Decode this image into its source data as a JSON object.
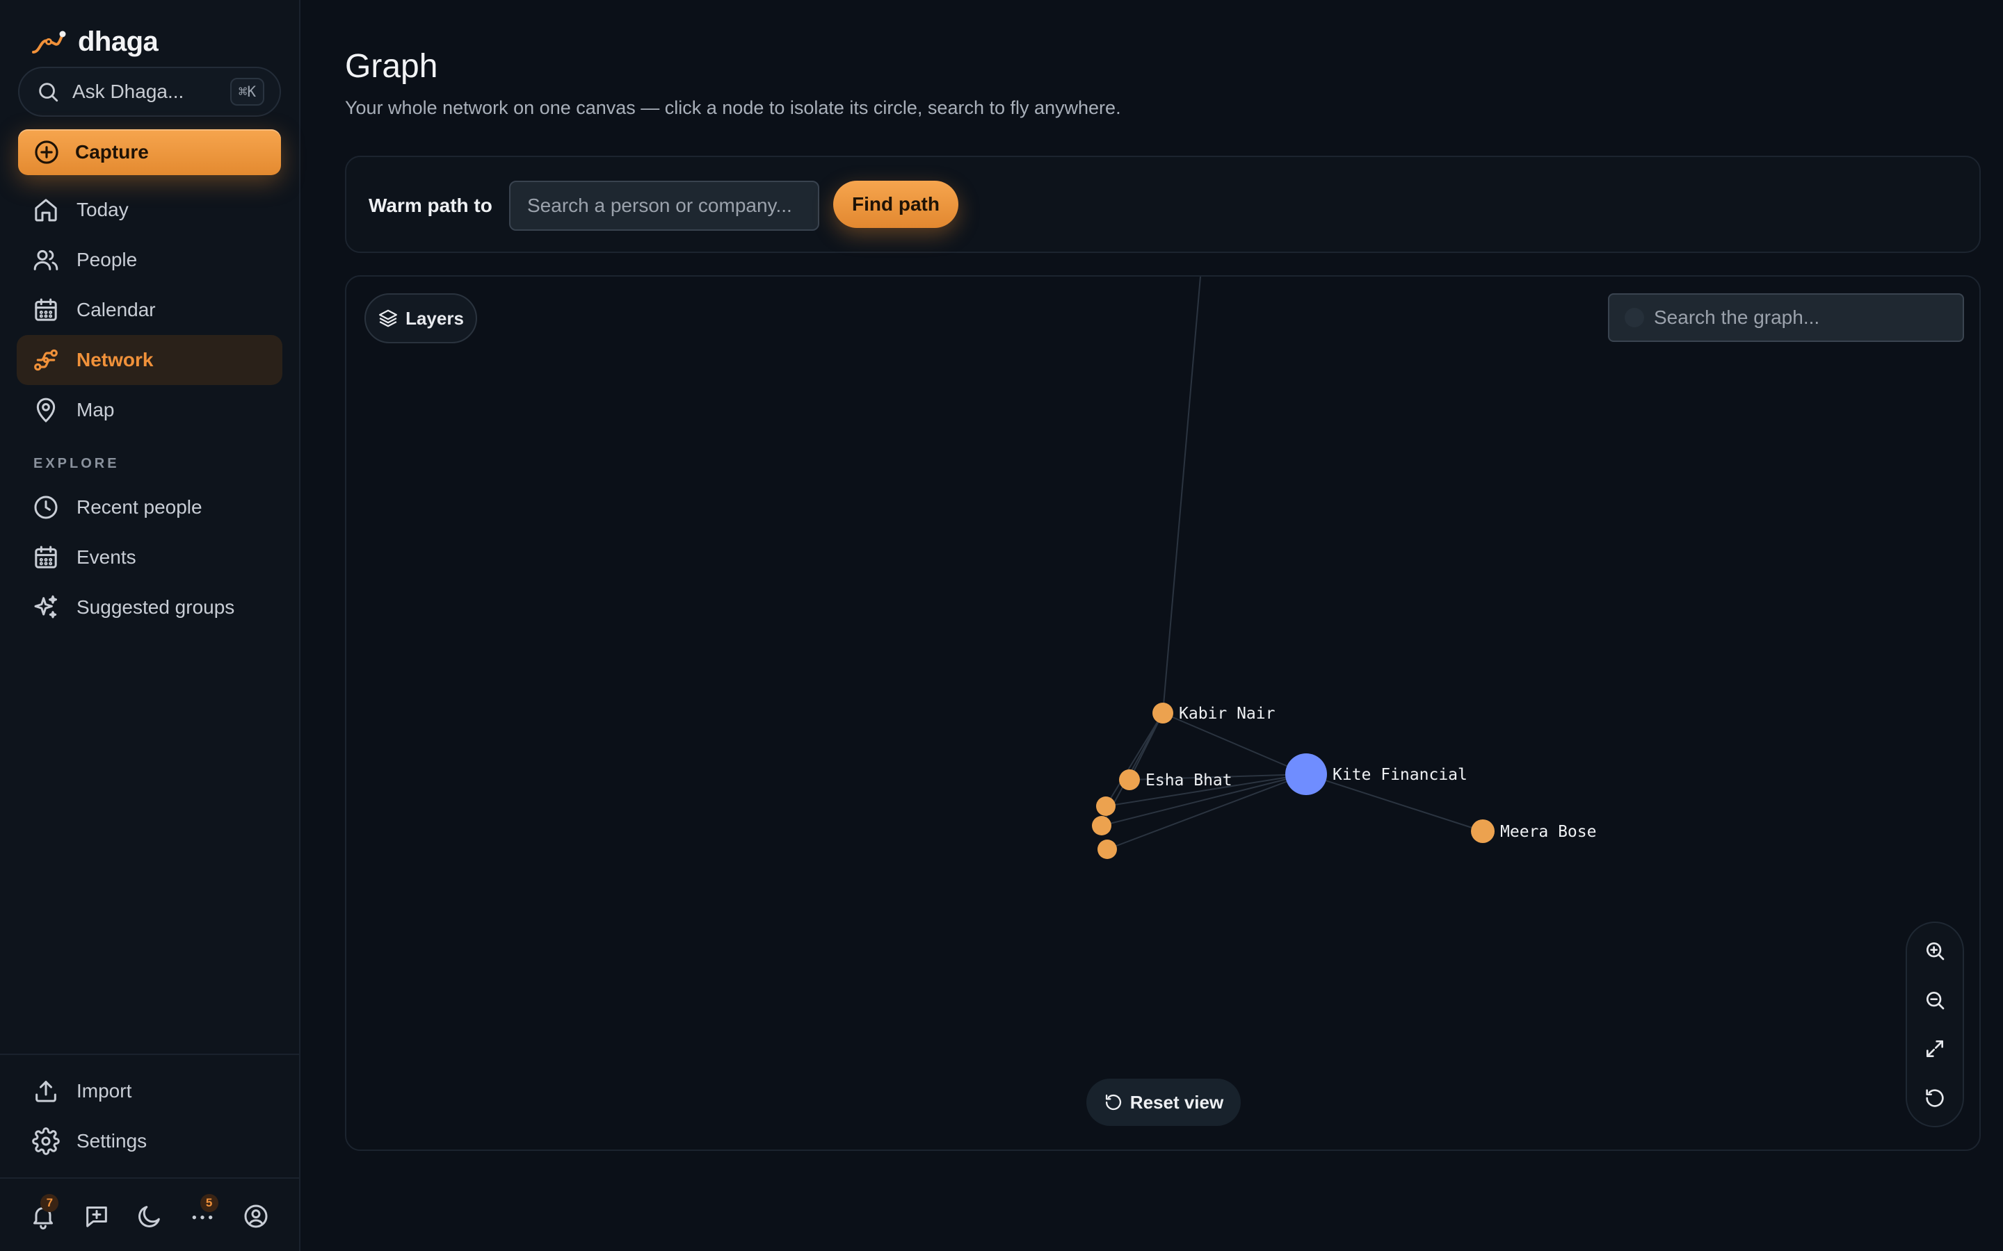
{
  "app": {
    "name": "dhaga"
  },
  "sidebar": {
    "ask_label": "Ask Dhaga...",
    "ask_shortcut": "⌘K",
    "capture_label": "Capture",
    "nav": [
      {
        "label": "Today",
        "icon": "home-icon"
      },
      {
        "label": "People",
        "icon": "people-icon"
      },
      {
        "label": "Calendar",
        "icon": "calendar-icon"
      },
      {
        "label": "Network",
        "icon": "network-icon",
        "active": true
      },
      {
        "label": "Map",
        "icon": "map-pin-icon"
      }
    ],
    "explore_label": "EXPLORE",
    "explore": [
      {
        "label": "Recent people",
        "icon": "clock-icon"
      },
      {
        "label": "Events",
        "icon": "calendar-icon"
      },
      {
        "label": "Suggested groups",
        "icon": "sparkles-icon"
      }
    ],
    "footer": [
      {
        "label": "Import",
        "icon": "upload-icon"
      },
      {
        "label": "Settings",
        "icon": "gear-icon"
      }
    ],
    "bottom_bar": {
      "notifications_count": "7",
      "more_count": "5"
    }
  },
  "main": {
    "title": "Graph",
    "subtitle": "Your whole network on one canvas — click a node to isolate its circle, search to fly anywhere.",
    "warm_path": {
      "label": "Warm path to",
      "placeholder": "Search a person or company...",
      "button": "Find path"
    },
    "graph": {
      "layers_label": "Layers",
      "search_placeholder": "Search the graph...",
      "reset_label": "Reset view",
      "nodes": [
        {
          "id": "kite",
          "label": "Kite Financial",
          "kind": "company"
        },
        {
          "id": "kabir",
          "label": "Kabir Nair",
          "kind": "person"
        },
        {
          "id": "esha",
          "label": "Esha Bhat",
          "kind": "person"
        },
        {
          "id": "meera",
          "label": "Meera Bose",
          "kind": "person"
        },
        {
          "id": "p1",
          "label": "",
          "kind": "person"
        },
        {
          "id": "p2",
          "label": "",
          "kind": "person"
        },
        {
          "id": "p3",
          "label": "",
          "kind": "person"
        }
      ],
      "colors": {
        "person": "#eca24f",
        "company": "#6f8dff",
        "edge": "#2b3440"
      }
    }
  }
}
